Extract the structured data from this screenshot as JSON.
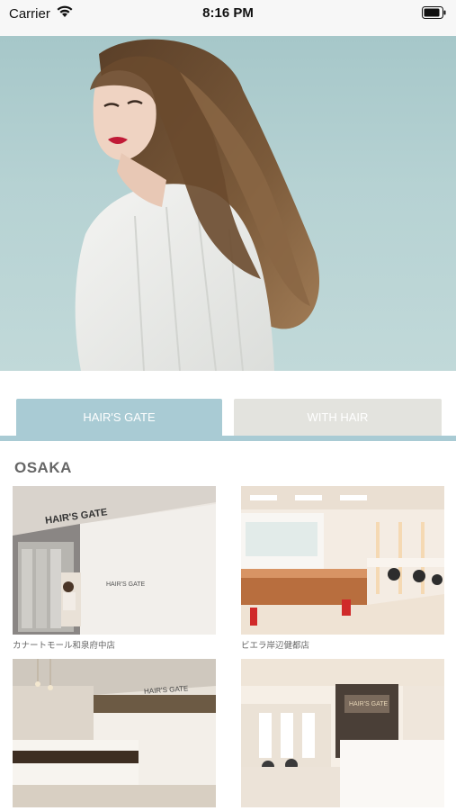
{
  "status_bar": {
    "carrier": "Carrier",
    "time": "8:16 PM"
  },
  "carousel": {
    "page_count": 5,
    "active_index": 1
  },
  "tabs": [
    {
      "label": "HAIR'S GATE",
      "active": true
    },
    {
      "label": "WITH HAIR",
      "active": false
    }
  ],
  "section": {
    "title": "OSAKA"
  },
  "salons": [
    {
      "caption": "カナートモール和泉府中店",
      "sign": "HAIR'S GATE"
    },
    {
      "caption": "ビエラ岸辺健都店",
      "sign": ""
    },
    {
      "caption": "",
      "sign": "HAIR'S GATE"
    },
    {
      "caption": "",
      "sign": "HAIR'S GATE"
    }
  ],
  "colors": {
    "tab_active": "#a9cbd4",
    "tab_inactive": "#e3e3de",
    "hero_bg": "#b6d2d3"
  }
}
